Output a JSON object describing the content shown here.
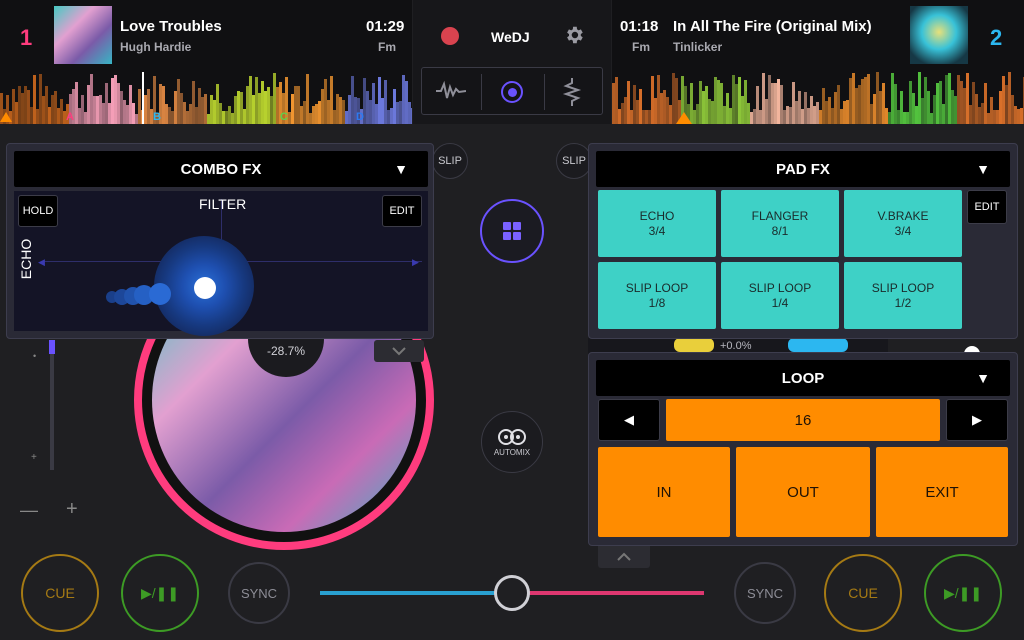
{
  "deck1": {
    "number": "1",
    "title": "Love Troubles",
    "artist": "Hugh Hardie",
    "time": "01:29",
    "key": "Fm",
    "cues": [
      "A",
      "B",
      "C",
      "D"
    ],
    "pitch": "-28.7%"
  },
  "deck2": {
    "number": "2",
    "title": "In All The Fire (Original Mix)",
    "artist": "Tinlicker",
    "time": "01:18",
    "key": "Fm",
    "pitch": "+0.0%"
  },
  "center": {
    "app_name": "WeDJ",
    "automix_label": "AUTOMIX",
    "slip_label": "SLIP"
  },
  "combo_fx": {
    "title": "COMBO FX",
    "hold_label": "HOLD",
    "edit_label": "EDIT",
    "x_label": "FILTER",
    "y_label": "ECHO"
  },
  "pad_fx": {
    "title": "PAD FX",
    "edit_label": "EDIT",
    "pads": [
      {
        "name": "ECHO",
        "value": "3/4"
      },
      {
        "name": "FLANGER",
        "value": "8/1"
      },
      {
        "name": "V.BRAKE",
        "value": "3/4"
      },
      {
        "name": "SLIP LOOP",
        "value": "1/8"
      },
      {
        "name": "SLIP LOOP",
        "value": "1/4"
      },
      {
        "name": "SLIP LOOP",
        "value": "1/2"
      }
    ]
  },
  "loop": {
    "title": "LOOP",
    "value": "16",
    "in_label": "IN",
    "out_label": "OUT",
    "exit_label": "EXIT"
  },
  "transport": {
    "cue_label": "CUE",
    "play_label": "▶/❚❚",
    "sync_label": "SYNC"
  },
  "tempo": {
    "minus": "—",
    "plus": "+"
  },
  "crossfader_position": 0.5,
  "colors": {
    "deck1": "#ff3c7e",
    "deck2": "#2cb7f0",
    "teal": "#3ed1c6",
    "orange": "#ff8c00",
    "cue_ring": "#a57a14",
    "play_ring": "#3d9b25"
  }
}
